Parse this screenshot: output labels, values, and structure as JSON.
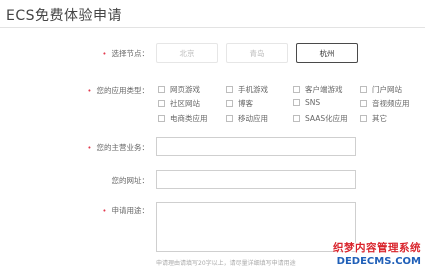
{
  "page": {
    "title": "ECS免费体验申请"
  },
  "node": {
    "label": "选择节点：",
    "options": [
      "北京",
      "青岛",
      "杭州"
    ],
    "selected": "杭州"
  },
  "apps": {
    "label": "您的应用类型：",
    "options": [
      "网页游戏",
      "手机游戏",
      "客户端游戏",
      "门户网站",
      "社区网站",
      "博客",
      "SNS",
      "音视频应用",
      "电商类应用",
      "移动应用",
      "SAAS化应用",
      "其它"
    ]
  },
  "business": {
    "label": "您的主营业务：",
    "value": ""
  },
  "website": {
    "label": "您的网址：",
    "value": ""
  },
  "usage": {
    "label": "申请用途：",
    "value": ""
  },
  "hint": "申请理由请填写20字以上，请尽量详细填写申请用途",
  "watermark": {
    "line1": "织梦内容管理系统",
    "line2": "DEDECMS.COM"
  },
  "colors": {
    "required": "#e2384d",
    "wm_red": "#d9242c",
    "wm_blue": "#1f5fb8"
  }
}
